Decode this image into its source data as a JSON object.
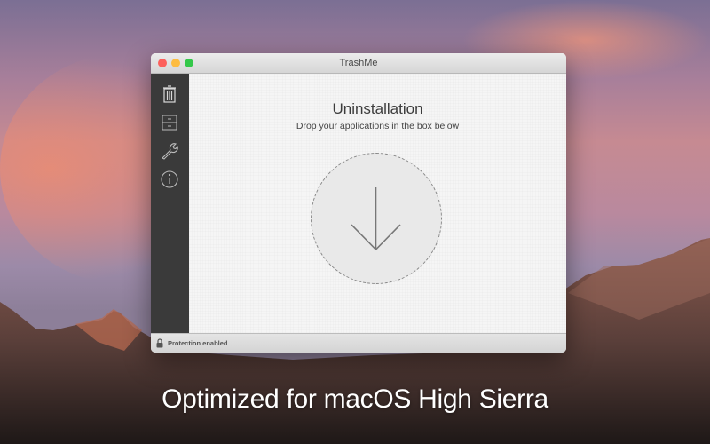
{
  "window": {
    "title": "TrashMe"
  },
  "sidebar": {
    "items": [
      {
        "name": "uninstall",
        "icon": "trash-icon"
      },
      {
        "name": "storage",
        "icon": "drawer-icon"
      },
      {
        "name": "tools",
        "icon": "wrench-icon"
      },
      {
        "name": "info",
        "icon": "info-icon"
      }
    ]
  },
  "main": {
    "title": "Uninstallation",
    "subtitle": "Drop your applications in the box below",
    "drop_icon": "arrow-down-icon"
  },
  "status": {
    "text": "Protection enabled",
    "icon": "lock-icon"
  },
  "tagline": "Optimized for macOS High Sierra",
  "colors": {
    "close": "#fc605c",
    "minimize": "#fdbc40",
    "zoom": "#34c84a",
    "sidebar": "#3a3a3a"
  }
}
